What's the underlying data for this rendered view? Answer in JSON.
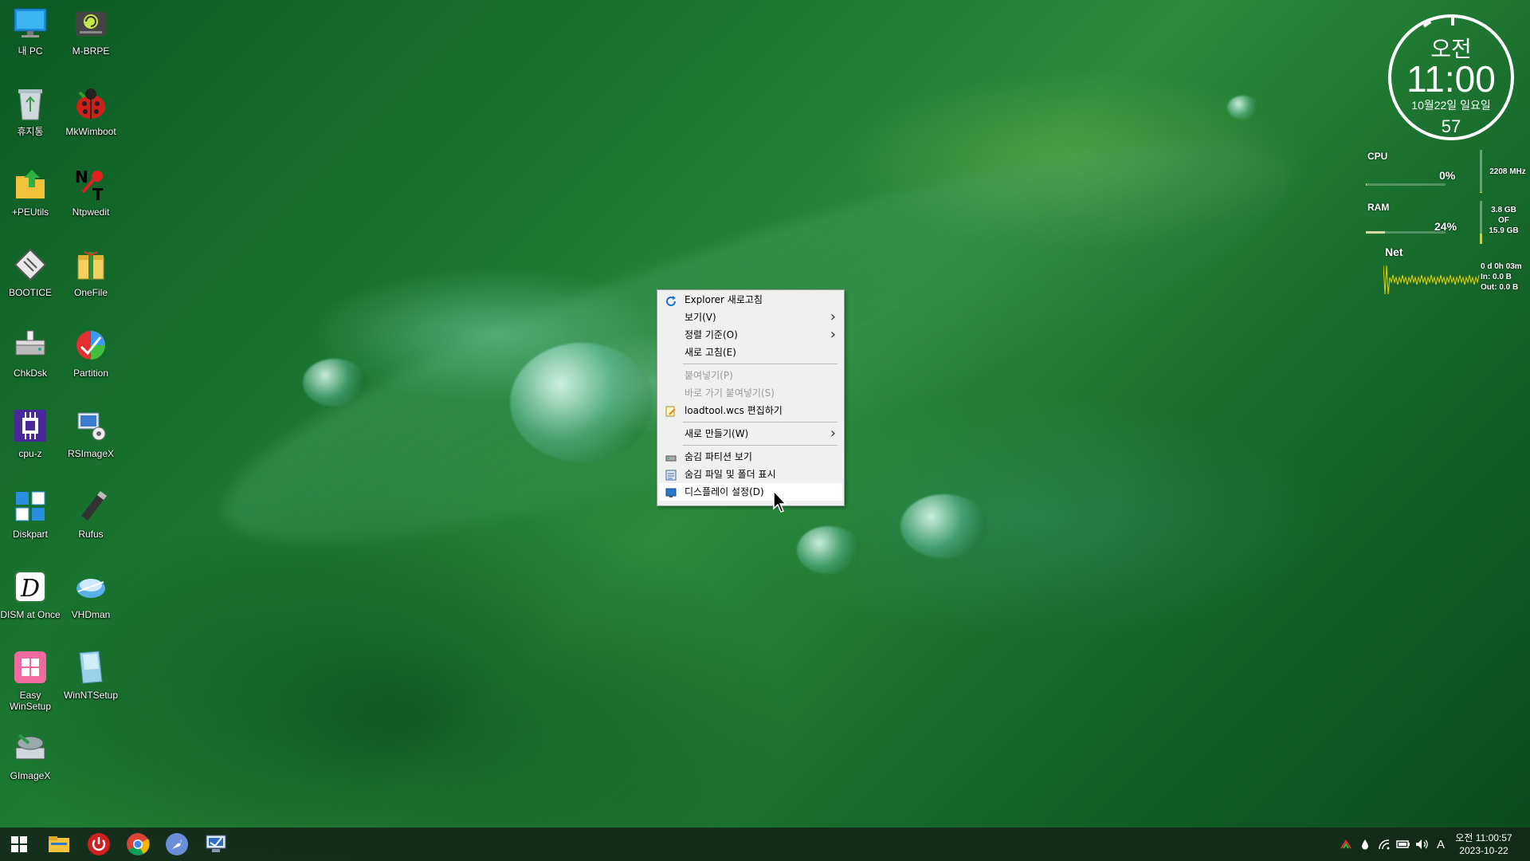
{
  "desktop": {
    "icons": [
      {
        "label": "내 PC",
        "icon": "monitor-icon"
      },
      {
        "label": "M-BRPE",
        "icon": "drive-icon"
      },
      {
        "label": "휴지통",
        "icon": "recycle-bin-icon"
      },
      {
        "label": "MkWimboot",
        "icon": "ladybug-icon"
      },
      {
        "label": "+PEUtils",
        "icon": "folder-up-icon"
      },
      {
        "label": "Ntpwedit",
        "icon": "key-icon"
      },
      {
        "label": "BOOTICE",
        "icon": "chip-icon"
      },
      {
        "label": "OneFile",
        "icon": "package-icon"
      },
      {
        "label": "ChkDsk",
        "icon": "disk-icon"
      },
      {
        "label": "Partition",
        "icon": "partition-icon"
      },
      {
        "label": "cpu-z",
        "icon": "cpu-icon"
      },
      {
        "label": "RSImageX",
        "icon": "imaging-icon"
      },
      {
        "label": "Diskpart",
        "icon": "tiles-icon"
      },
      {
        "label": "Rufus",
        "icon": "usb-icon"
      },
      {
        "label": "DISM at Once",
        "icon": "dism-icon"
      },
      {
        "label": "VHDman",
        "icon": "vhd-icon"
      },
      {
        "label": "Easy WinSetup",
        "icon": "windows-icon"
      },
      {
        "label": "WinNTSetup",
        "icon": "setup-icon"
      },
      {
        "label": "GImageX",
        "icon": "gimagex-icon"
      }
    ]
  },
  "clock_gadget": {
    "ampm": "오전",
    "time": "11:00",
    "date": "10월22일 일요일",
    "seconds": "57"
  },
  "meters": {
    "cpu": {
      "label": "CPU",
      "percent": "0%",
      "side": "2208 MHz",
      "level": 0.01
    },
    "ram": {
      "label": "RAM",
      "percent": "24%",
      "side_line1": "3.8 GB",
      "side_line2": "OF",
      "side_line3": "15.9 GB",
      "level": 0.24
    },
    "net": {
      "label": "Net",
      "uptime": "0 d 0h 03m",
      "in": "In: 0.0 B",
      "out": "Out: 0.0 B"
    },
    "accent_color": "#e8d000"
  },
  "context_menu": {
    "items": [
      {
        "label": "Explorer 새로고침",
        "icon": "refresh-icon",
        "disabled": false
      },
      {
        "label": "보기(V)",
        "submenu": true,
        "disabled": false
      },
      {
        "label": "정렬 기준(O)",
        "submenu": true,
        "disabled": false
      },
      {
        "label": "새로 고침(E)",
        "disabled": false
      },
      {
        "label": "붙여넣기(P)",
        "disabled": true
      },
      {
        "label": "바로 가기 붙여넣기(S)",
        "disabled": true
      },
      {
        "label": "loadtool.wcs 편집하기",
        "icon": "edit-icon",
        "disabled": false
      },
      {
        "label": "새로 만들기(W)",
        "submenu": true,
        "disabled": false
      },
      {
        "label": "숨김 파티션 보기",
        "icon": "partition-view-icon",
        "disabled": false
      },
      {
        "label": "숨김 파일 및 폴더 표시",
        "icon": "folder-options-icon",
        "disabled": false
      },
      {
        "label": "디스플레이 설정(D)",
        "icon": "display-icon",
        "disabled": false,
        "highlighted": true
      }
    ]
  },
  "taskbar": {
    "pinned": [
      "windows-start-icon",
      "file-explorer-icon",
      "power-icon",
      "chrome-icon",
      "rocket-icon",
      "remote-desktop-icon"
    ],
    "tray": {
      "input_indicator": "A",
      "clock_time": "오전 11:00:57",
      "clock_date": "2023-10-22"
    }
  }
}
